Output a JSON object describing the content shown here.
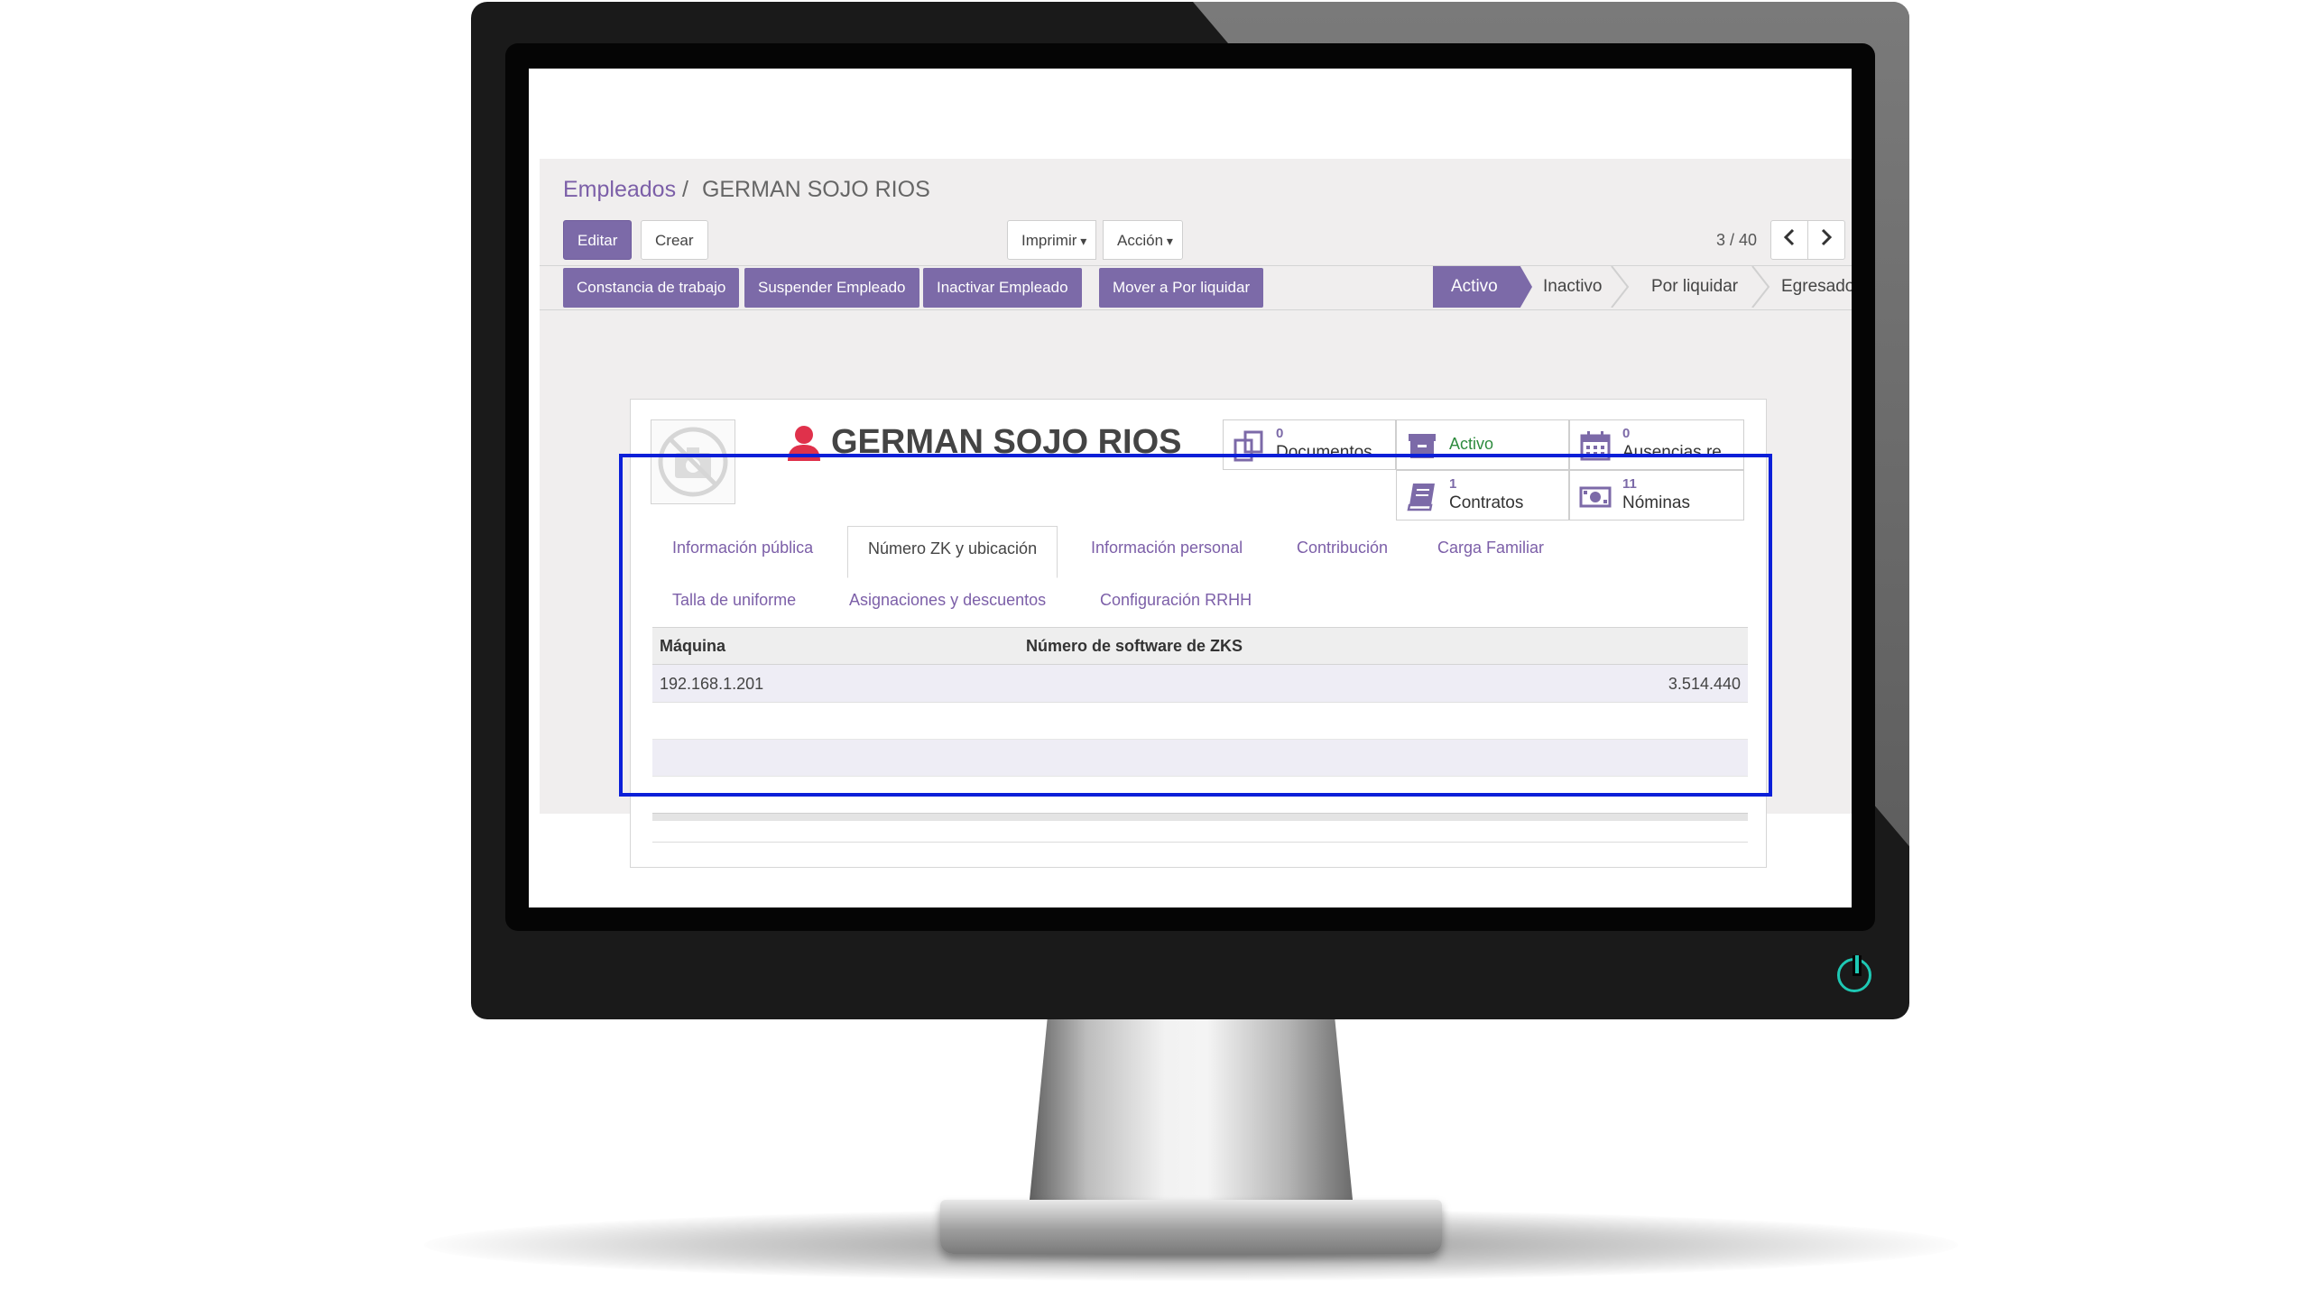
{
  "breadcrumb": {
    "parent": "Empleados",
    "separator": "/",
    "current": "GERMAN SOJO RIOS"
  },
  "toolbar": {
    "edit_label": "Editar",
    "create_label": "Crear",
    "print_label": "Imprimir",
    "action_label": "Acción"
  },
  "pager": {
    "value": "3 / 40"
  },
  "header_buttons": [
    "Constancia de trabajo",
    "Suspender Empleado",
    "Inactivar Empleado",
    "Mover a Por liquidar"
  ],
  "stages": {
    "active": "Activo",
    "items": [
      "Inactivo",
      "Por liquidar",
      "Egresado"
    ]
  },
  "employee": {
    "name": "GERMAN SOJO RIOS"
  },
  "smart_buttons": {
    "documents": {
      "count": "0",
      "label": "Documentos"
    },
    "status": {
      "label": "Activo"
    },
    "absences": {
      "count": "0",
      "label": "Ausencias re..."
    },
    "contracts": {
      "count": "1",
      "label": "Contratos"
    },
    "payslips": {
      "count": "11",
      "label": "Nóminas"
    }
  },
  "tabs": {
    "row1": [
      "Información pública",
      "Número ZK y ubicación",
      "Información personal",
      "Contribución",
      "Carga Familiar"
    ],
    "row2": [
      "Talla de uniforme",
      "Asignaciones y descuentos",
      "Configuración RRHH"
    ],
    "active": "Número ZK y ubicación"
  },
  "zk_table": {
    "columns": [
      "Máquina",
      "Número de software de ZKS"
    ],
    "rows": [
      {
        "machine": "192.168.1.201",
        "software_number": "3.514.440"
      }
    ]
  },
  "colors": {
    "primary": "#7c6aa8",
    "link": "#7c5fa8",
    "highlight_box": "#0b1fd8",
    "status_green": "#2e8b3e",
    "person_icon": "#e0314b",
    "power_led": "#1ec8b4"
  }
}
